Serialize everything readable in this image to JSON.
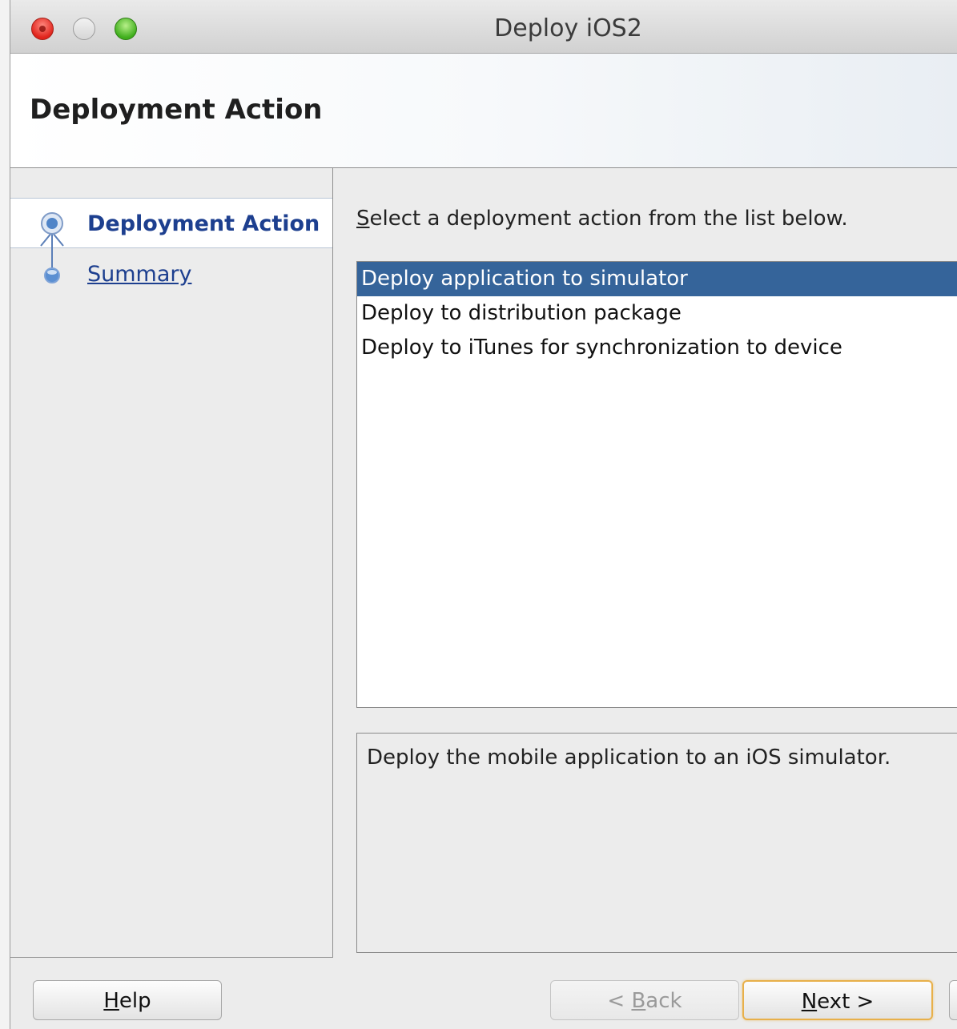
{
  "window": {
    "title": "Deploy iOS2"
  },
  "header": {
    "title": "Deployment Action"
  },
  "steps": [
    {
      "label": "Deployment Action",
      "active": true
    },
    {
      "label": "Summary",
      "active": false
    }
  ],
  "main": {
    "instruction": "Select a deployment action from the list below.",
    "actions": [
      {
        "label": "Deploy application to simulator",
        "selected": true
      },
      {
        "label": "Deploy to distribution package",
        "selected": false
      },
      {
        "label": "Deploy to iTunes for synchronization to device",
        "selected": false
      }
    ],
    "description": "Deploy the mobile application to an iOS simulator."
  },
  "buttons": {
    "help": "Help",
    "back": "< Back",
    "next": "Next >"
  },
  "colors": {
    "selection": "#35649a",
    "step_text": "#1d3f8f",
    "default_button_ring": "#e8b04a"
  }
}
